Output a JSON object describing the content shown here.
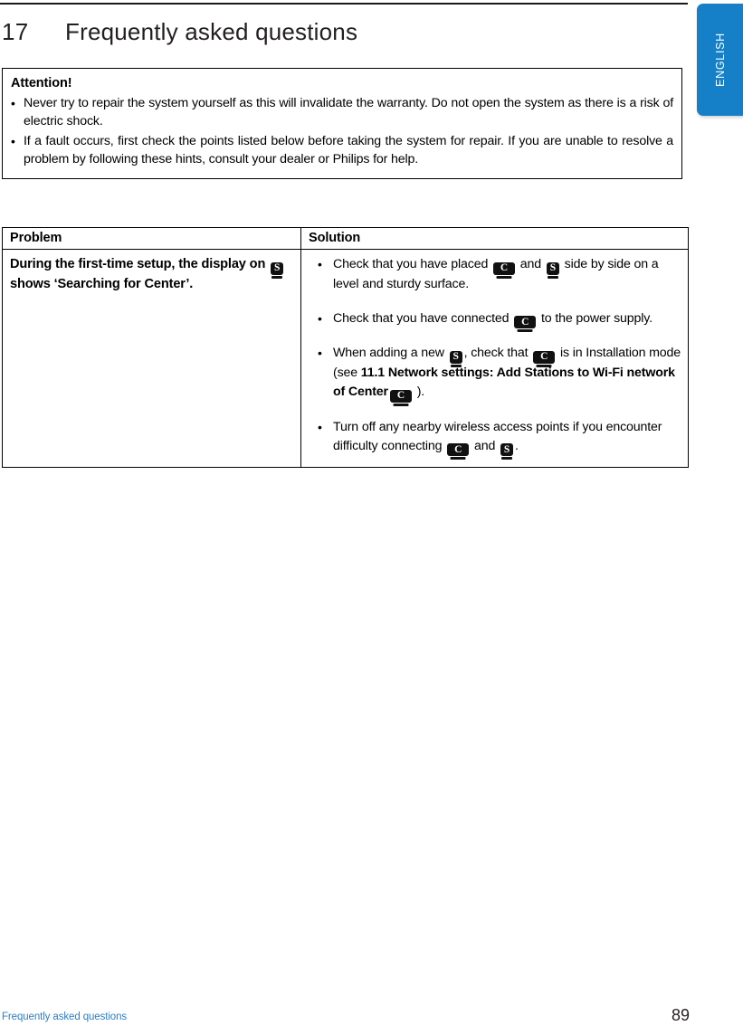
{
  "page": {
    "language_tab": "ENGLISH",
    "accent_blue": "#1580c7",
    "footer_link_blue": "#2b7fc4"
  },
  "heading": {
    "number": "17",
    "title": "Frequently asked questions"
  },
  "attention": {
    "title": "Attention!",
    "bullet_mark": "•",
    "items": [
      "Never try to repair the system yourself as this will invalidate the warranty. Do not open the system as there is a risk of electric shock.",
      "If a fault occurs, first check the points listed below before taking the system for repair. If you are unable to resolve a problem by following these hints, consult your dealer or Philips for help."
    ]
  },
  "table": {
    "headers": {
      "problem": "Problem",
      "solution": "Solution"
    },
    "bullet_mark": "•",
    "row": {
      "problem": {
        "part1": "During the first-time setup, the display on",
        "badge1": "S",
        "part2": "shows ‘Searching for Center’."
      },
      "solution_bullets": [
        {
          "part1": "Check that you have placed",
          "badge1": "C",
          "part2": "and",
          "badge2": "S",
          "part3": "side by side on a level and sturdy surface."
        },
        {
          "part1": "Check that you have connected",
          "badge1": "C",
          "part2": "to the power supply."
        },
        {
          "part1": "When adding a new",
          "badge1": "S",
          "part2": ", check that",
          "badge2": "C",
          "part3": "is in Installation mode (see",
          "bold1": "11.1 Network settings: Add Stations to Wi-Fi network of Center",
          "badge3": "C",
          "part4": ")."
        },
        {
          "part1": "Turn off any nearby wireless access points if you encounter difficulty connecting",
          "badge1": "C",
          "part2": "and",
          "badge2": "S",
          "part3": "."
        }
      ]
    }
  },
  "footer": {
    "section": "Frequently asked questions",
    "page_number": "89"
  }
}
